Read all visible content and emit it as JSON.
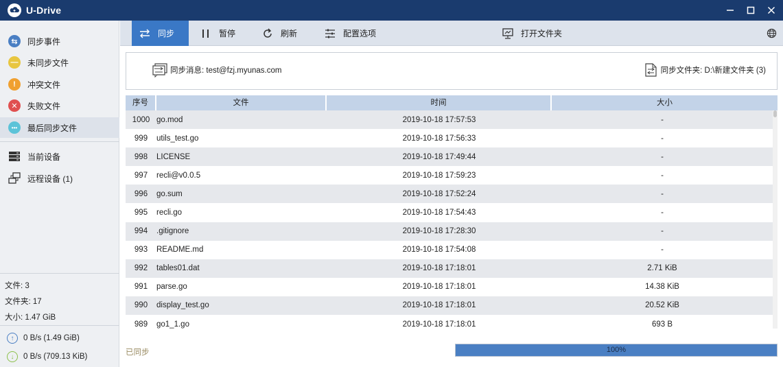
{
  "app": {
    "title": "U-Drive"
  },
  "sidebar": {
    "items": [
      {
        "label": "同步事件",
        "icon": "sync-event-icon",
        "color": "#4a7fc3",
        "glyph": "⇆"
      },
      {
        "label": "未同步文件",
        "icon": "unsynced-icon",
        "color": "#e8c640",
        "glyph": "—"
      },
      {
        "label": "冲突文件",
        "icon": "conflict-icon",
        "color": "#f0a030",
        "glyph": "!"
      },
      {
        "label": "失败文件",
        "icon": "failed-icon",
        "color": "#e05050",
        "glyph": "✕"
      },
      {
        "label": "最后同步文件",
        "icon": "last-sync-icon",
        "color": "#5cc3d8",
        "glyph": "•••"
      }
    ],
    "devices": [
      {
        "label": "当前设备",
        "icon": "current-device-icon"
      },
      {
        "label": "远程设备 (1)",
        "icon": "remote-device-icon"
      }
    ],
    "stats": {
      "files": "文件: 3",
      "folders": "文件夹: 17",
      "size": "大小: 1.47 GiB"
    },
    "upload": "0 B/s (1.49 GiB)",
    "download": "0 B/s (709.13 KiB)"
  },
  "toolbar": {
    "sync": "同步",
    "pause": "暂停",
    "refresh": "刷新",
    "config": "配置选项",
    "open_folder": "打开文件夹"
  },
  "info": {
    "message": "同步消息: test@fzj.myunas.com",
    "folder": "同步文件夹: D:\\新建文件夹 (3)"
  },
  "table": {
    "headers": [
      "序号",
      "文件",
      "时间",
      "大小"
    ],
    "rows": [
      {
        "idx": "1000",
        "file": "go.mod",
        "time": "2019-10-18  17:57:53",
        "size": "-"
      },
      {
        "idx": "999",
        "file": "utils_test.go",
        "time": "2019-10-18  17:56:33",
        "size": "-"
      },
      {
        "idx": "998",
        "file": "LICENSE",
        "time": "2019-10-18  17:49:44",
        "size": "-"
      },
      {
        "idx": "997",
        "file": "recli@v0.0.5",
        "time": "2019-10-18  17:59:23",
        "size": "-"
      },
      {
        "idx": "996",
        "file": "go.sum",
        "time": "2019-10-18  17:52:24",
        "size": "-"
      },
      {
        "idx": "995",
        "file": "recli.go",
        "time": "2019-10-18  17:54:43",
        "size": "-"
      },
      {
        "idx": "994",
        "file": ".gitignore",
        "time": "2019-10-18  17:28:30",
        "size": "-"
      },
      {
        "idx": "993",
        "file": "README.md",
        "time": "2019-10-18  17:54:08",
        "size": "-"
      },
      {
        "idx": "992",
        "file": "tables01.dat",
        "time": "2019-10-18  17:18:01",
        "size": "2.71 KiB"
      },
      {
        "idx": "991",
        "file": "parse.go",
        "time": "2019-10-18  17:18:01",
        "size": "14.38 KiB"
      },
      {
        "idx": "990",
        "file": "display_test.go",
        "time": "2019-10-18  17:18:01",
        "size": "20.52 KiB"
      },
      {
        "idx": "989",
        "file": "go1_1.go",
        "time": "2019-10-18  17:18:01",
        "size": "693 B"
      }
    ]
  },
  "footer": {
    "status": "已同步",
    "progress_label": "100%",
    "progress": 1.0
  },
  "colors": {
    "titlebar": "#1a3b6e",
    "accent": "#3a78c6",
    "status_text": "#9a8c63"
  }
}
